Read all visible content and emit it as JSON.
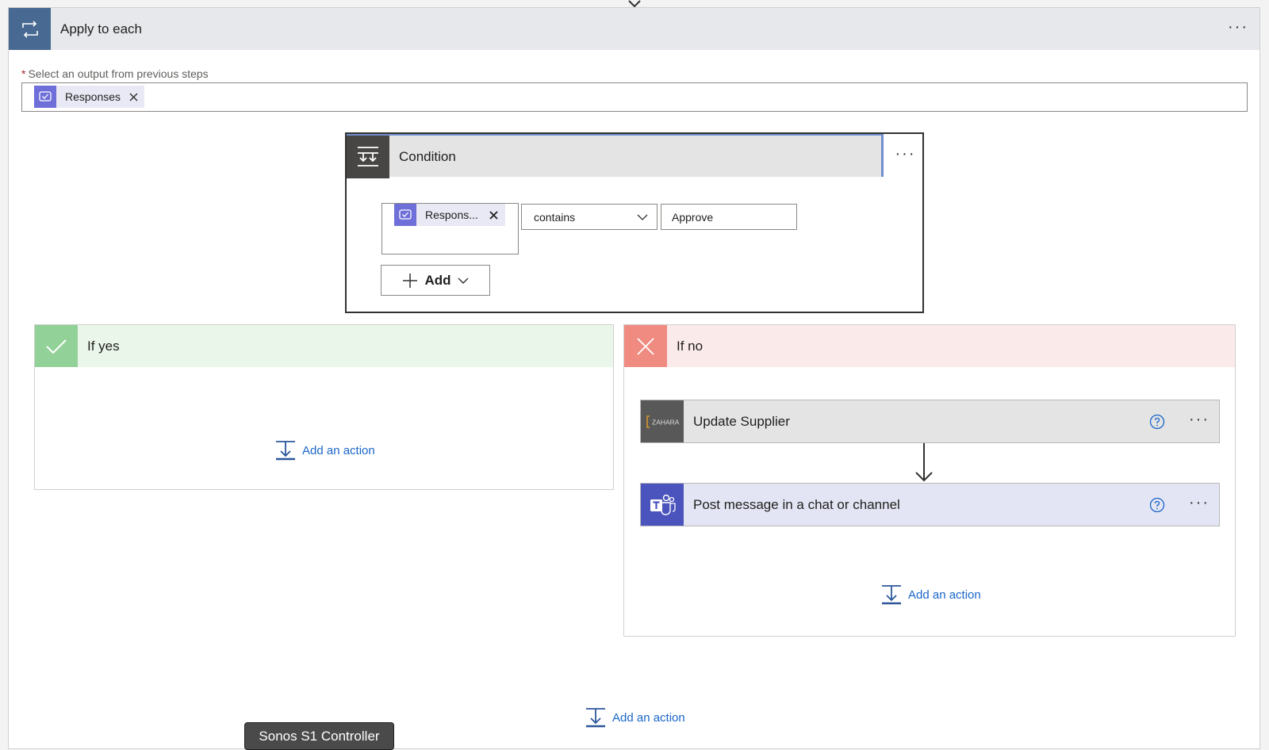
{
  "apply_to_each": {
    "title": "Apply to each",
    "more": "···",
    "select_label": "Select an output from previous steps",
    "required_marker": "*",
    "token_label": "Responses",
    "token_close": "✕"
  },
  "condition": {
    "title": "Condition",
    "more": "···",
    "left_token_label": "Respons...",
    "left_token_close": "✕",
    "operator": "contains",
    "right_value": "Approve",
    "add_label": "Add"
  },
  "if_yes": {
    "title": "If yes",
    "add_action": "Add an action"
  },
  "if_no": {
    "title": "If no",
    "actions": [
      {
        "title": "Update Supplier",
        "icon": "zahara-logo",
        "logo_text": "ZAHARA"
      },
      {
        "title": "Post message in a chat or channel",
        "icon": "teams-icon"
      }
    ],
    "add_action": "Add an action"
  },
  "bottom": {
    "add_action": "Add an action"
  },
  "tooltip": "Sonos S1 Controller",
  "colors": {
    "link": "#1a66c9",
    "apply_icon_bg": "#486991",
    "yes_header": "#eaf6ea",
    "yes_icon": "#92d197",
    "no_header": "#fbeaea",
    "no_icon": "#ef8b80",
    "teams": "#4b53bc",
    "approvals": "#6e6fd9"
  }
}
